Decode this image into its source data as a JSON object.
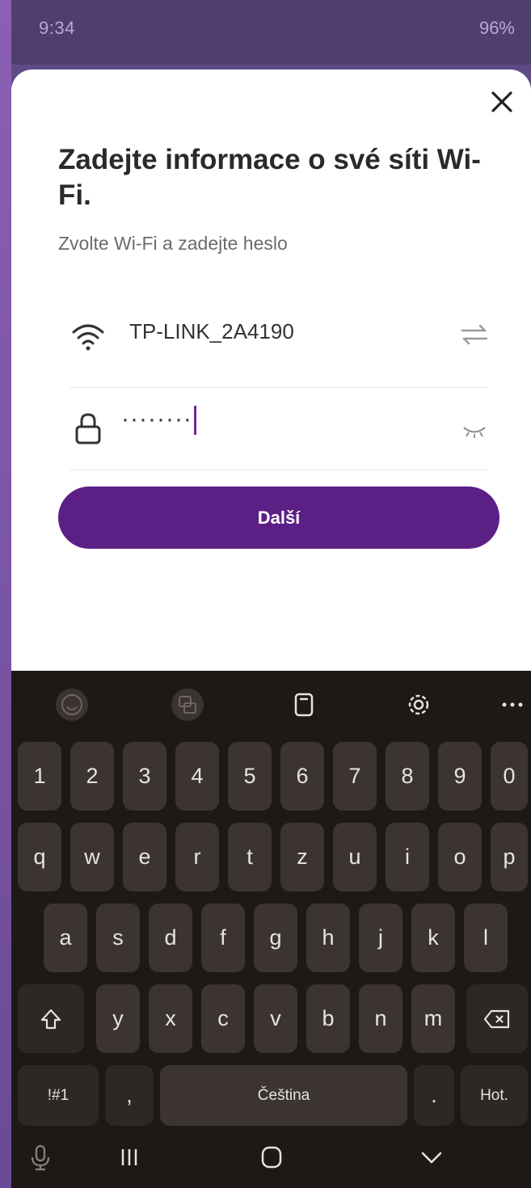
{
  "status_bar": {
    "time": "9:34",
    "battery": "96%"
  },
  "sheet": {
    "title": "Zadejte informace o své síti Wi-Fi.",
    "subtitle": "Zvolte Wi-Fi a zadejte heslo",
    "network_name": "TP-LINK_2A4190",
    "password_masked": "········",
    "next_label": "Další"
  },
  "keyboard": {
    "number_row": [
      "1",
      "2",
      "3",
      "4",
      "5",
      "6",
      "7",
      "8",
      "9",
      "0"
    ],
    "row1": [
      "q",
      "w",
      "e",
      "r",
      "t",
      "z",
      "u",
      "i",
      "o",
      "p"
    ],
    "row2": [
      "a",
      "s",
      "d",
      "f",
      "g",
      "h",
      "j",
      "k",
      "l"
    ],
    "row3": [
      "y",
      "x",
      "c",
      "v",
      "b",
      "n",
      "m"
    ],
    "symbols_label": "!#1",
    "comma_label": ",",
    "space_label": "Čeština",
    "period_label": ".",
    "done_label": "Hot."
  },
  "colors": {
    "accent": "#5c1f86",
    "keyboard_bg": "#1e1917",
    "key_bg": "#3c3430"
  },
  "icons": [
    "wifi-icon",
    "lock-icon",
    "swap-icon",
    "eye-closed-icon",
    "close-icon",
    "emoji-icon",
    "translate-icon",
    "clipboard-icon",
    "settings-icon",
    "more-icon",
    "shift-icon",
    "backspace-icon",
    "mic-icon",
    "recents-icon",
    "home-icon",
    "back-icon"
  ]
}
